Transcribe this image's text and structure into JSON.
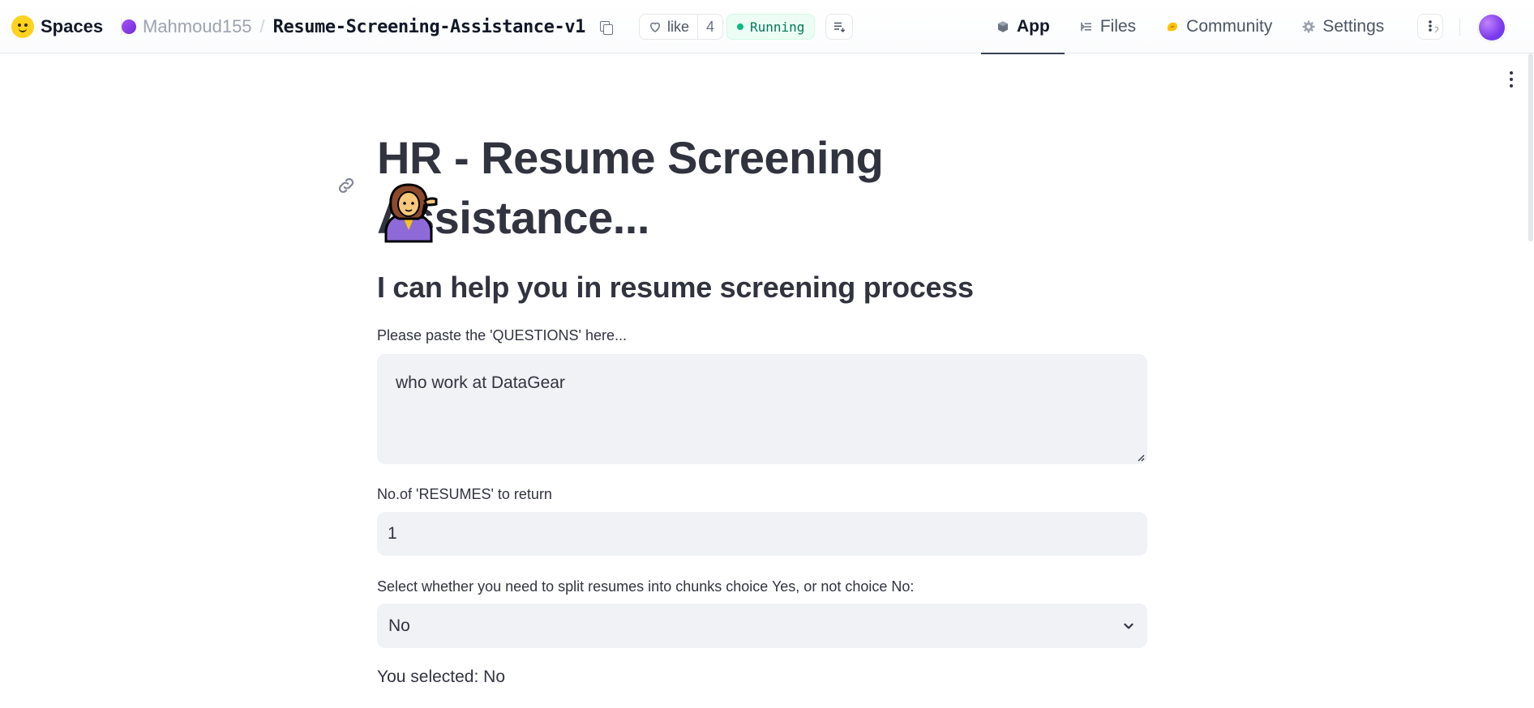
{
  "header": {
    "brand": "Spaces",
    "owner": "Mahmoud155",
    "separator": "/",
    "repo_name": "Resume-Screening-Assistance-v1",
    "like_label": "like",
    "like_count": "4",
    "status": "Running",
    "tabs": [
      {
        "label": "App",
        "icon": "cube-icon",
        "active": true
      },
      {
        "label": "Files",
        "icon": "files-icon",
        "active": false
      },
      {
        "label": "Community",
        "icon": "community-icon",
        "active": false
      },
      {
        "label": "Settings",
        "icon": "gear-icon",
        "active": false
      }
    ]
  },
  "app": {
    "title": "HR - Resume Screening Assistance...",
    "subtitle": "I can help you in resume screening process",
    "questions": {
      "label": "Please paste the 'QUESTIONS' here...",
      "value": "who work at DataGear"
    },
    "resumes_count": {
      "label": "No.of 'RESUMES' to return",
      "value": "1"
    },
    "split_select": {
      "label": "Select whether you need to split resumes into chunks choice Yes, or not choice No:",
      "value": "No"
    },
    "selected_text": "You selected: No"
  },
  "colors": {
    "text": "#31333f",
    "input_bg": "#f0f2f6",
    "running_green": "#10b981",
    "status_bg": "#ecfdf5"
  }
}
